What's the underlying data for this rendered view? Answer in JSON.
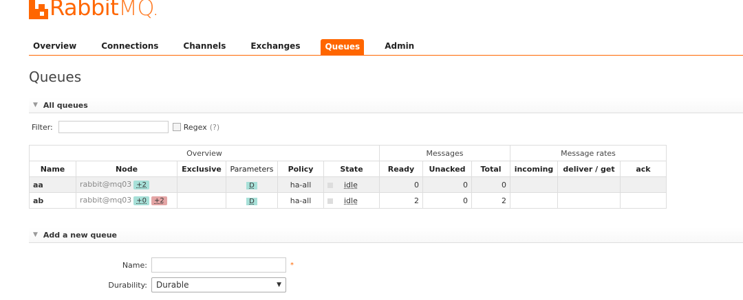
{
  "logo": {
    "rabbit": "Rabbit",
    "mq": "MQ",
    "dot": "."
  },
  "tabs": [
    {
      "label": "Overview",
      "active": false
    },
    {
      "label": "Connections",
      "active": false
    },
    {
      "label": "Channels",
      "active": false
    },
    {
      "label": "Exchanges",
      "active": false
    },
    {
      "label": "Queues",
      "active": true
    },
    {
      "label": "Admin",
      "active": false
    }
  ],
  "page_title": "Queues",
  "all_queues": {
    "header": "All queues",
    "filter_label": "Filter:",
    "filter_value": "",
    "regex_label": "Regex",
    "regex_help": "(?)"
  },
  "table": {
    "groups": {
      "overview": "Overview",
      "messages": "Messages",
      "rates": "Message rates"
    },
    "columns": [
      "Name",
      "Node",
      "Exclusive",
      "Parameters",
      "Policy",
      "State",
      "Ready",
      "Unacked",
      "Total",
      "incoming",
      "deliver / get",
      "ack"
    ],
    "rows": [
      {
        "name": "aa",
        "node": "rabbit@mq03",
        "badges": [
          {
            "text": "+2",
            "color": "green"
          }
        ],
        "exclusive": "",
        "parameters": "D",
        "policy": "ha-all",
        "state": "idle",
        "ready": "0",
        "unacked": "0",
        "total": "0",
        "incoming": "",
        "deliver_get": "",
        "ack": ""
      },
      {
        "name": "ab",
        "node": "rabbit@mq03",
        "badges": [
          {
            "text": "+0",
            "color": "green"
          },
          {
            "text": "+2",
            "color": "red"
          }
        ],
        "exclusive": "",
        "parameters": "D",
        "policy": "ha-all",
        "state": "idle",
        "ready": "2",
        "unacked": "0",
        "total": "2",
        "incoming": "",
        "deliver_get": "",
        "ack": ""
      }
    ]
  },
  "add_queue": {
    "header": "Add a new queue",
    "name_label": "Name:",
    "name_value": "",
    "required_mark": "*",
    "durability_label": "Durability:",
    "durability_value": "Durable"
  },
  "colors": {
    "accent": "#ff6600"
  }
}
